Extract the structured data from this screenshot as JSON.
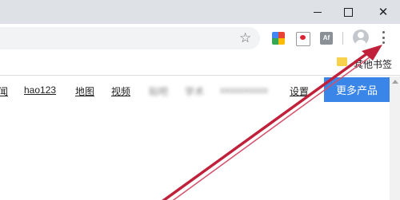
{
  "window": {
    "controls": [
      "minimize",
      "maximize",
      "close"
    ]
  },
  "toolbar": {
    "bookmark_icon": "star-icon",
    "extensions": [
      "colorful-extension-icon",
      "screen-record-extension-icon",
      "acrobat-extension-icon"
    ],
    "acrobat_text": "Af",
    "profile_icon": "avatar-icon",
    "menu_icon": "three-dots-menu-icon"
  },
  "bookmarks_bar": {
    "other_bookmarks_label": "其他书签"
  },
  "page_nav": {
    "links": [
      {
        "label": "闻",
        "blurred": false
      },
      {
        "label": "hao123",
        "blurred": false
      },
      {
        "label": "地图",
        "blurred": false
      },
      {
        "label": "视频",
        "blurred": false
      },
      {
        "label": "贴吧",
        "blurred": true
      },
      {
        "label": "学术",
        "blurred": true
      },
      {
        "label": "xxxxxxxxxx",
        "blurred": true
      },
      {
        "label": "设置",
        "blurred": false
      }
    ],
    "more_products_label": "更多产品"
  },
  "annotation": {
    "arrow_color": "#c0203a"
  }
}
